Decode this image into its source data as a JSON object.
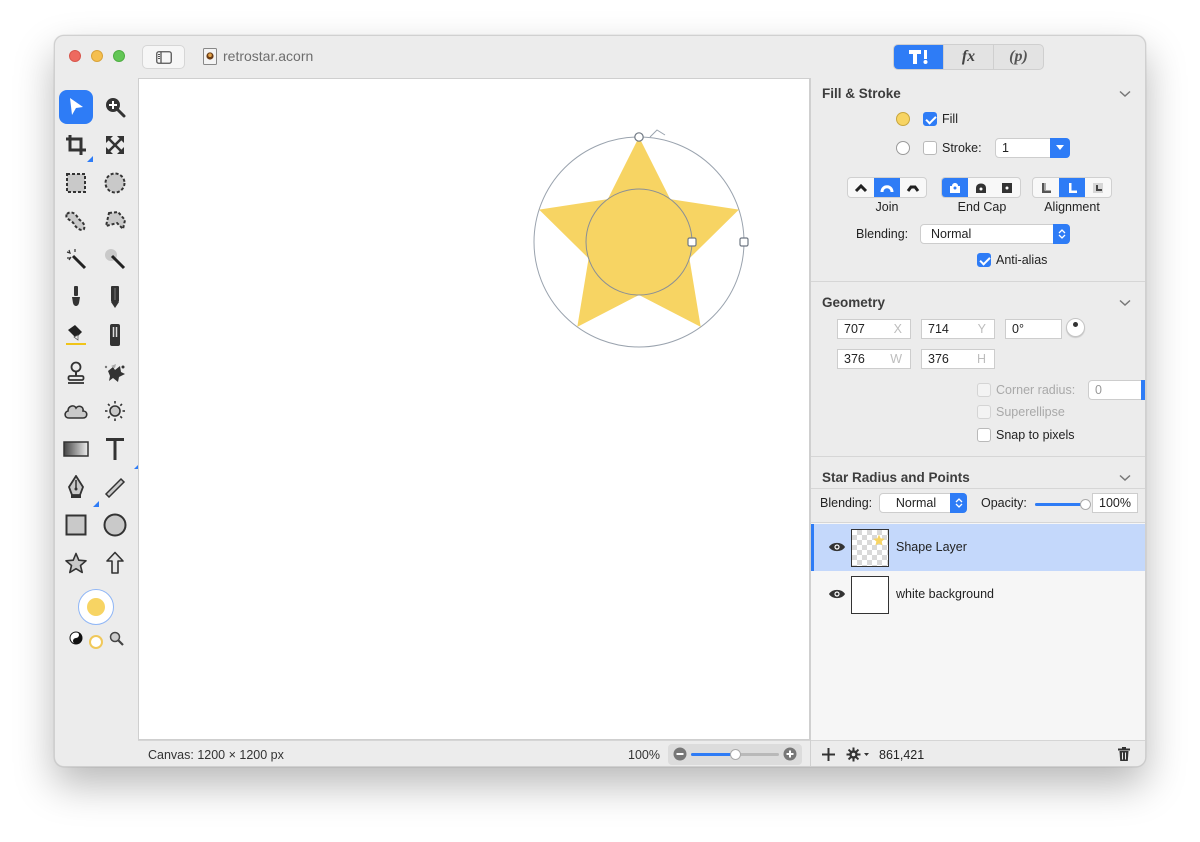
{
  "window": {
    "title": "retrostar.acorn",
    "traffic_lights": [
      "close",
      "minimize",
      "maximize"
    ]
  },
  "inspector_tabs": [
    {
      "name": "tools",
      "icon": "hammer-brush-icon",
      "active": true
    },
    {
      "name": "filters",
      "label": "fx",
      "active": false
    },
    {
      "name": "properties",
      "label": "(p)",
      "active": false
    }
  ],
  "toolbox": {
    "tools": [
      {
        "name": "select-tool",
        "icon": "arrow-pointer-icon",
        "active": true
      },
      {
        "name": "zoom-tool",
        "icon": "magnifier-plus-icon"
      },
      {
        "name": "crop-tool",
        "icon": "crop-icon",
        "has_submenu": true
      },
      {
        "name": "transform-tool",
        "icon": "expand-arrows-icon"
      },
      {
        "name": "rect-select-tool",
        "icon": "dashed-rect-icon"
      },
      {
        "name": "ellipse-select-tool",
        "icon": "dashed-circle-icon"
      },
      {
        "name": "lasso-tool",
        "icon": "lasso-icon"
      },
      {
        "name": "polygon-lasso-tool",
        "icon": "polygon-lasso-icon"
      },
      {
        "name": "magic-wand-tool",
        "icon": "magic-wand-icon"
      },
      {
        "name": "instant-alpha-tool",
        "icon": "instant-alpha-wand-icon"
      },
      {
        "name": "brush-tool",
        "icon": "brush-icon"
      },
      {
        "name": "pencil-tool",
        "icon": "pencil-icon"
      },
      {
        "name": "paint-bucket-tool",
        "icon": "paint-bucket-icon"
      },
      {
        "name": "eraser-tool",
        "icon": "eraser-icon"
      },
      {
        "name": "clone-tool",
        "icon": "stamp-icon"
      },
      {
        "name": "smudge-tool",
        "icon": "splatter-icon"
      },
      {
        "name": "burn-tool",
        "icon": "cloud-icon"
      },
      {
        "name": "dodge-tool",
        "icon": "sun-icon"
      },
      {
        "name": "gradient-tool",
        "icon": "gradient-icon"
      },
      {
        "name": "text-tool",
        "icon": "text-t-icon",
        "has_submenu": true
      },
      {
        "name": "pen-tool",
        "icon": "pen-nib-icon",
        "has_submenu": true
      },
      {
        "name": "line-tool",
        "icon": "line-icon"
      },
      {
        "name": "rectangle-tool",
        "icon": "square-icon"
      },
      {
        "name": "oval-tool",
        "icon": "circle-icon"
      },
      {
        "name": "star-tool",
        "icon": "star-icon"
      },
      {
        "name": "arrow-tool",
        "icon": "arrow-up-icon"
      }
    ],
    "color_well": {
      "color": "#f7d463"
    },
    "mini_tools": [
      "swap-colors-icon",
      "default-colors-icon",
      "eyedropper-zoom-icon"
    ]
  },
  "canvas": {
    "shape": "star",
    "fill_color": "#f7d463",
    "points": 5
  },
  "statusbar": {
    "canvas_size": "Canvas: 1200 × 1200 px",
    "zoom_level": "100%",
    "zoom_slider_value": 0.5
  },
  "inspector": {
    "fill_stroke": {
      "title": "Fill & Stroke",
      "fill_color": "#f7d463",
      "fill_label": "Fill",
      "fill_checked": true,
      "stroke_color": "#ffffff",
      "stroke_label": "Stroke:",
      "stroke_checked": false,
      "stroke_width": "1",
      "join_label": "Join",
      "join_options": [
        "miter",
        "round",
        "bevel"
      ],
      "join_selected": 1,
      "endcap_label": "End Cap",
      "endcap_options": [
        "butt",
        "round",
        "square"
      ],
      "endcap_selected": 0,
      "alignment_label": "Alignment",
      "alignment_options": [
        "outside",
        "center",
        "inside"
      ],
      "alignment_selected": 1,
      "blending_label": "Blending:",
      "blending_value": "Normal",
      "antialias_label": "Anti-alias",
      "antialias_checked": true
    },
    "geometry": {
      "title": "Geometry",
      "x": "707",
      "x_label": "X",
      "y": "714",
      "y_label": "Y",
      "rotation": "0°",
      "w": "376",
      "w_label": "W",
      "h": "376",
      "h_label": "H",
      "corner_radius_label": "Corner radius:",
      "corner_radius": "0",
      "corner_radius_enabled": false,
      "superellipse_label": "Superellipse",
      "superellipse_enabled": false,
      "snap_label": "Snap to pixels",
      "snap_checked": false
    },
    "star": {
      "title": "Star Radius and Points"
    },
    "layer_controls": {
      "blending_label": "Blending:",
      "blending_value": "Normal",
      "opacity_label": "Opacity:",
      "opacity_value": "100%",
      "opacity_fraction": 1.0
    },
    "layers": [
      {
        "name": "Shape Layer",
        "visible": true,
        "selected": true,
        "thumb": "checker-star"
      },
      {
        "name": "white background",
        "visible": true,
        "selected": false,
        "thumb": "white"
      }
    ],
    "bottom": {
      "coordinates": "861,421"
    }
  }
}
